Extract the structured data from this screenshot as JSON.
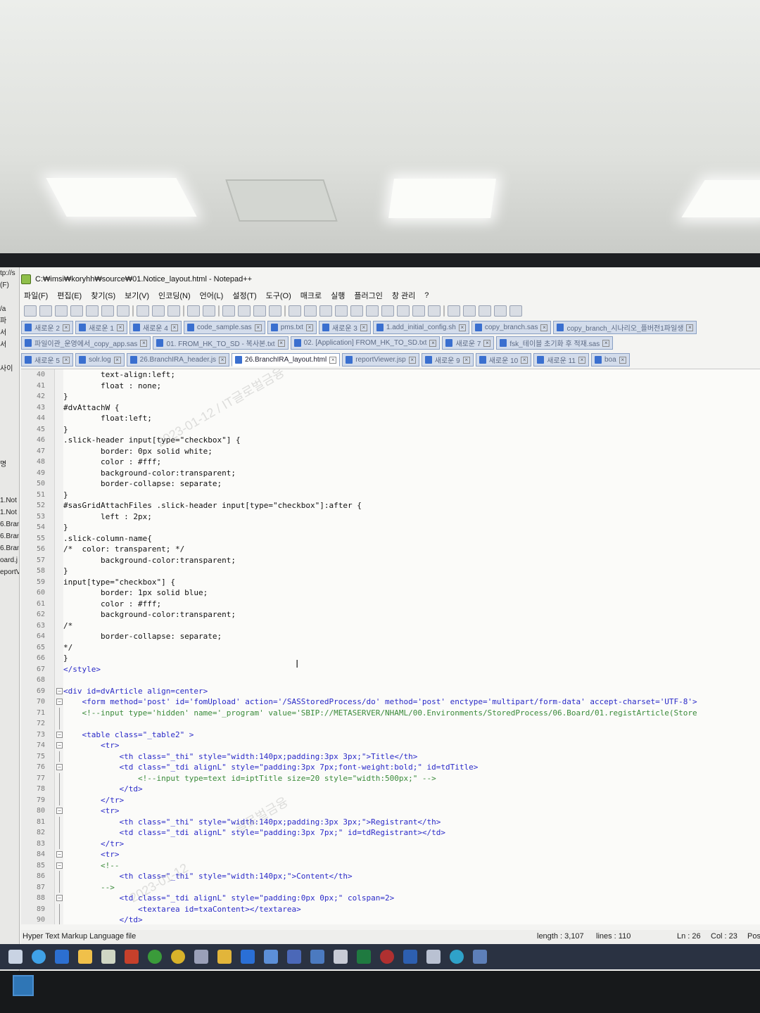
{
  "window": {
    "title": "C:₩imsi₩koryhh₩source₩01.Notice_layout.html - Notepad++"
  },
  "menu": [
    "파일(F)",
    "편집(E)",
    "찾기(S)",
    "보기(V)",
    "인코딩(N)",
    "언어(L)",
    "설정(T)",
    "도구(O)",
    "매크로",
    "실행",
    "플러그인",
    "창 관리",
    "?"
  ],
  "tabs": {
    "row1": [
      "새로운 2",
      "새로운 1",
      "새로운 4",
      "code_sample.sas",
      "pms.txt",
      "새로운 3",
      "1.add_initial_config.sh",
      "copy_branch.sas",
      "copy_branch_시나리오_플버전1파일생"
    ],
    "row2": [
      "파일이관_운영에서_copy_app.sas",
      "01. FROM_HK_TO_SD - 복사본.txt",
      "02. [Application] FROM_HK_TO_SD.txt",
      "새로운 7",
      "fsk_테이블 초기화 후 적재.sas"
    ],
    "row3": [
      "새로운 5",
      "solr.log",
      "26.BranchIRA_header.js",
      "26.BranchIRA_layout.html",
      "reportViewer.jsp",
      "새로운 9",
      "새로운 10",
      "새로운 11",
      "boa"
    ],
    "active": "26.BranchIRA_layout.html"
  },
  "left_pane": [
    "tp://s",
    "(F)",
    "",
    "/a",
    "파",
    "서",
    "서",
    "",
    "사이",
    "",
    "",
    "",
    "",
    "",
    "",
    "",
    "명",
    "",
    "",
    "1.Not",
    "1.Not",
    "6.Bran",
    "6.Bran",
    "6.Bran",
    "oard.j",
    "eportV"
  ],
  "code_lines": [
    {
      "n": "40",
      "t": "        text-align:left;"
    },
    {
      "n": "41",
      "t": "        float : none;"
    },
    {
      "n": "42",
      "t": "}"
    },
    {
      "n": "43",
      "t": "#dvAttachW {"
    },
    {
      "n": "44",
      "t": "        float:left;"
    },
    {
      "n": "45",
      "t": "}"
    },
    {
      "n": "46",
      "t": ".slick-header input[type=\"checkbox\"] {"
    },
    {
      "n": "47",
      "t": "        border: 0px solid white;"
    },
    {
      "n": "48",
      "t": "        color : #fff;"
    },
    {
      "n": "49",
      "t": "        background-color:transparent;"
    },
    {
      "n": "50",
      "t": "        border-collapse: separate;"
    },
    {
      "n": "51",
      "t": "}"
    },
    {
      "n": "52",
      "t": "#sasGridAttachFiles .slick-header input[type=\"checkbox\"]:after {"
    },
    {
      "n": "53",
      "t": "        left : 2px;"
    },
    {
      "n": "54",
      "t": "}"
    },
    {
      "n": "55",
      "t": ".slick-column-name{"
    },
    {
      "n": "56",
      "t": "/*  color: transparent; */"
    },
    {
      "n": "57",
      "t": "        background-color:transparent;"
    },
    {
      "n": "58",
      "t": "}"
    },
    {
      "n": "59",
      "t": "input[type=\"checkbox\"] {"
    },
    {
      "n": "60",
      "t": "        border: 1px solid blue;"
    },
    {
      "n": "61",
      "t": "        color : #fff;"
    },
    {
      "n": "62",
      "t": "        background-color:transparent;"
    },
    {
      "n": "63",
      "t": "/*"
    },
    {
      "n": "64",
      "t": "        border-collapse: separate;"
    },
    {
      "n": "65",
      "t": "*/"
    },
    {
      "n": "66",
      "t": "}"
    },
    {
      "n": "67",
      "t": "</style>"
    },
    {
      "n": "68",
      "t": ""
    },
    {
      "n": "69",
      "t": "<div id=dvArticle align=center>"
    },
    {
      "n": "70",
      "t": "    <form method='post' id='fomUpload' action='/SASStoredProcess/do' method='post' enctype='multipart/form-data' accept-charset='UTF-8'>"
    },
    {
      "n": "71",
      "t": "    <!--input type='hidden' name='_program' value='SBIP://METASERVER/NHAML/00.Environments/StoredProcess/06.Board/01.registArticle(Store"
    },
    {
      "n": "72",
      "t": ""
    },
    {
      "n": "73",
      "t": "    <table class=\"_table2\" >"
    },
    {
      "n": "74",
      "t": "        <tr>"
    },
    {
      "n": "75",
      "t": "            <th class=\"_thi\" style=\"width:140px;padding:3px 3px;\">Title</th>"
    },
    {
      "n": "76",
      "t": "            <td class=\"_tdi alignL\" style=\"padding:3px 7px;font-weight:bold;\" id=tdTitle>"
    },
    {
      "n": "77",
      "t": "                <!--input type=text id=iptTitle size=20 style=\"width:500px;\" -->"
    },
    {
      "n": "78",
      "t": "            </td>"
    },
    {
      "n": "79",
      "t": "        </tr>"
    },
    {
      "n": "80",
      "t": "        <tr>"
    },
    {
      "n": "81",
      "t": "            <th class=\"_thi\" style=\"width:140px;padding:3px 3px;\">Registrant</th>"
    },
    {
      "n": "82",
      "t": "            <td class=\"_tdi alignL\" style=\"padding:3px 7px;\" id=tdRegistrant></td>"
    },
    {
      "n": "83",
      "t": "        </tr>"
    },
    {
      "n": "84",
      "t": "        <tr>"
    },
    {
      "n": "85",
      "t": "        <!--"
    },
    {
      "n": "86",
      "t": "            <th class=\"_thi\" style=\"width:140px;\">Content</th>"
    },
    {
      "n": "87",
      "t": "        -->"
    },
    {
      "n": "88",
      "t": "            <td class=\"_tdi alignL\" style=\"padding:0px 0px;\" colspan=2>"
    },
    {
      "n": "89",
      "t": "                <textarea id=txaContent></textarea>"
    },
    {
      "n": "90",
      "t": "            </td>"
    }
  ],
  "status": {
    "file_type": "Hyper Text Markup Language file",
    "length": "length : 3,107",
    "lines": "lines : 110",
    "ln": "Ln : 26",
    "col": "Col : 23",
    "pos": "Pos"
  },
  "colors": {
    "tag": "#2a2ac8",
    "attr": "#d24a1e",
    "value": "#7a2fa0",
    "comment": "#3a8a3a"
  }
}
